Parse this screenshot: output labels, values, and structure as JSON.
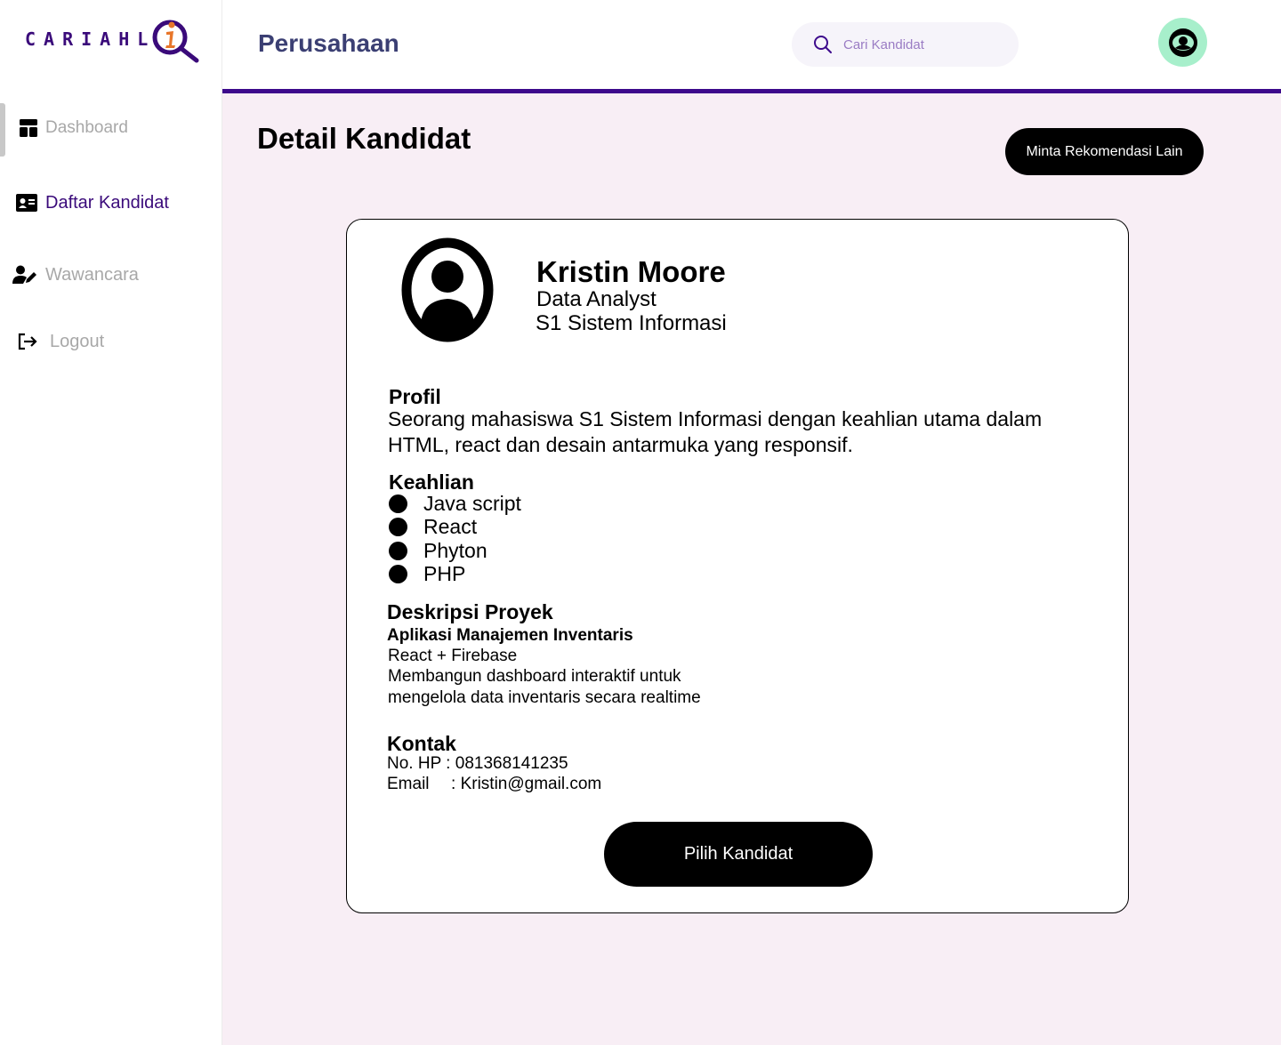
{
  "logo": {
    "text": "CARIAHL"
  },
  "sidebar": {
    "items": [
      {
        "label": "Dashboard",
        "icon": "dashboard-icon"
      },
      {
        "label": "Daftar Kandidat",
        "icon": "id-card-icon"
      },
      {
        "label": "Wawancara",
        "icon": "user-edit-icon"
      },
      {
        "label": "Logout",
        "icon": "logout-icon"
      }
    ]
  },
  "header": {
    "title": "Perusahaan",
    "search_placeholder": "Cari Kandidat",
    "avatar_icon": "user-circle-icon"
  },
  "main": {
    "page_title": "Detail Kandidat",
    "recommend_button": "Minta Rekomendasi Lain"
  },
  "candidate": {
    "name": "Kristin Moore",
    "role": "Data Analyst",
    "education": "S1 Sistem Informasi",
    "profile_title": "Profil",
    "profile_text": "Seorang mahasiswa S1 Sistem Informasi dengan keahlian utama dalam HTML, react dan desain antarmuka yang responsif.",
    "skills_title": "Keahlian",
    "skills": [
      "Java script",
      "React",
      "Phyton",
      "PHP"
    ],
    "project_title": "Deskripsi Proyek",
    "project_name": "Aplikasi Manajemen Inventaris",
    "project_tech": "React + Firebase",
    "project_desc": "Membangun dashboard interaktif untuk mengelola data inventaris secara realtime",
    "contact_title": "Kontak",
    "phone_label": "No. HP",
    "phone": "081368141235",
    "email_label": "Email",
    "email": "Kristin@gmail.com",
    "select_button": "Pilih Kandidat"
  },
  "colors": {
    "brand": "#3d0a8c",
    "background": "#f8eef5",
    "avatar_bg": "#a7efcb",
    "header_title": "#3b3f73",
    "inactive_nav": "#a8a8a8"
  }
}
